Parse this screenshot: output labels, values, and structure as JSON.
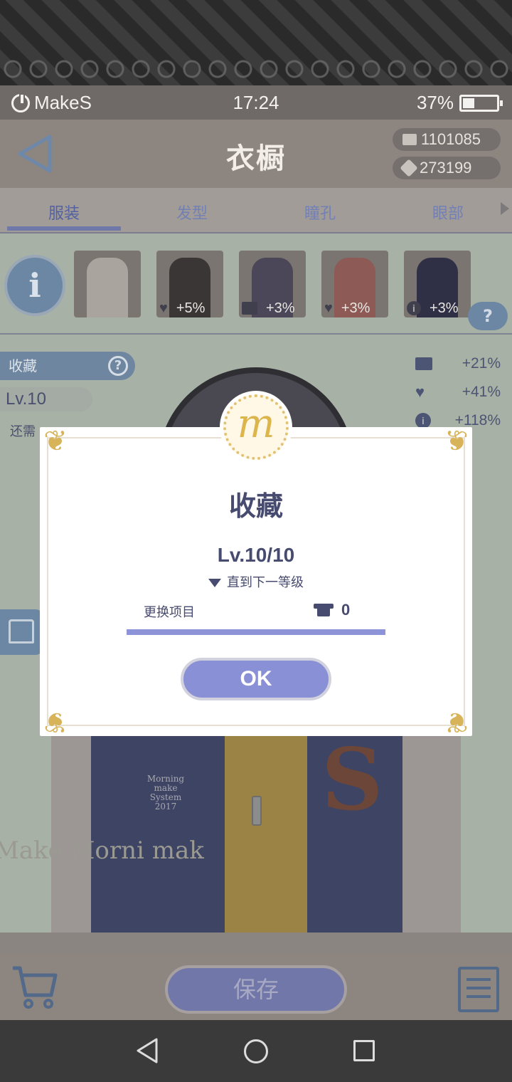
{
  "status_bar": {
    "carrier": "MakeS",
    "time": "17:24",
    "battery": "37%"
  },
  "header": {
    "title": "衣橱",
    "currency_1": "1101085",
    "currency_2": "273199"
  },
  "tabs": [
    {
      "label": "服装",
      "active": true
    },
    {
      "label": "发型",
      "active": false
    },
    {
      "label": "瞳孔",
      "active": false
    },
    {
      "label": "眼部",
      "active": false
    }
  ],
  "items": [
    {
      "bonus": "",
      "icon": "none"
    },
    {
      "bonus": "+5%",
      "icon": "heart-icon"
    },
    {
      "bonus": "+3%",
      "icon": "book-icon"
    },
    {
      "bonus": "+3%",
      "icon": "heart-icon"
    },
    {
      "bonus": "+3%",
      "icon": "info-icon"
    }
  ],
  "side_panel": {
    "collect_label": "收藏",
    "level": "Lv.10",
    "need_text": "还需"
  },
  "stats": [
    {
      "icon": "book-icon",
      "value": "+21%"
    },
    {
      "icon": "heart-icon",
      "value": "+41%"
    },
    {
      "icon": "info-icon",
      "value": "+118%"
    }
  ],
  "jacket_print": "Morning make System 2017",
  "watermark": "Make Morni mak",
  "modal": {
    "title": "收藏",
    "level": "Lv.10/10",
    "next_label": "直到下一等级",
    "change_label": "更换项目",
    "change_count": "0",
    "progress": 1.0,
    "ok_label": "OK"
  },
  "bottom": {
    "save_label": "保存"
  },
  "colors": {
    "accent": "#8990d6",
    "text_dark": "#474b6f",
    "gold": "#d7b45a"
  }
}
